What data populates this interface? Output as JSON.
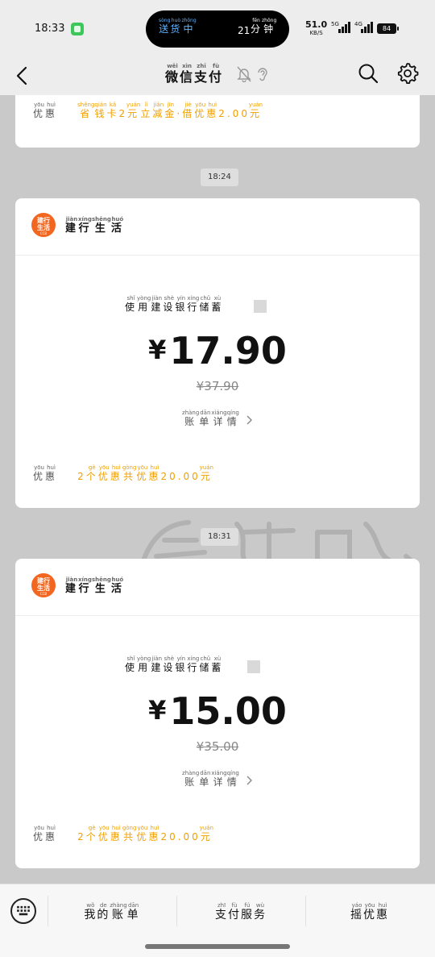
{
  "status_bar": {
    "time": "18:33",
    "island_left": [
      [
        "送",
        "sòng"
      ],
      [
        "货",
        "huò"
      ],
      [
        "中",
        "zhōng"
      ]
    ],
    "island_number": "21",
    "island_right": [
      [
        "分",
        "fēn"
      ],
      [
        "钟",
        "zhōng"
      ]
    ],
    "net_speed": "51.0",
    "net_unit": "KB/S",
    "sig1_label": "5G",
    "sig2_label": "4G",
    "battery": "84"
  },
  "header": {
    "title": [
      [
        "微",
        "wēi"
      ],
      [
        "信",
        "xìn"
      ],
      [
        "支",
        "zhī"
      ],
      [
        "付",
        "fù"
      ]
    ]
  },
  "top_card": {
    "discount_label": [
      [
        "优",
        "yōu"
      ],
      [
        "惠",
        "huì"
      ]
    ],
    "discount_pre": [
      [
        "省",
        "shěng"
      ],
      [
        "钱",
        "qián"
      ],
      [
        "卡",
        "kǎ"
      ]
    ],
    "discount_num": "2",
    "discount_mid": [
      [
        "元",
        "yuán"
      ],
      [
        "立",
        "lì"
      ],
      [
        "减",
        "jiǎn"
      ],
      [
        "金",
        "jīn"
      ]
    ],
    "discount_sep": "·",
    "discount_mid2": [
      [
        "借",
        "jiè"
      ],
      [
        "优",
        "yōu"
      ],
      [
        "惠",
        "huì"
      ]
    ],
    "discount_amount": "2.00",
    "discount_unit": [
      [
        "元",
        "yuán"
      ]
    ]
  },
  "messages": [
    {
      "time": "18:24",
      "merchant": [
        [
          "建",
          "jiàn"
        ],
        [
          "行",
          "xíng"
        ],
        [
          "生",
          "shēng"
        ],
        [
          "活",
          "huó"
        ]
      ],
      "logo_line1": "建行",
      "logo_line2": "生活",
      "logo_small": "CCB",
      "desc": [
        [
          "使",
          "shǐ"
        ],
        [
          "用",
          "yòng"
        ],
        [
          "建",
          "jiàn"
        ],
        [
          "设",
          "shè"
        ],
        [
          "银",
          "yín"
        ],
        [
          "行",
          "xíng"
        ],
        [
          "储",
          "chǔ"
        ],
        [
          "蓄",
          "xù"
        ]
      ],
      "amount": "17.90",
      "currency": "¥",
      "original": "¥37.90",
      "detail": [
        [
          "账",
          "zhàng"
        ],
        [
          "单",
          "dān"
        ],
        [
          "详",
          "xiáng"
        ],
        [
          "情",
          "qíng"
        ]
      ],
      "discount_label": [
        [
          "优",
          "yōu"
        ],
        [
          "惠",
          "huì"
        ]
      ],
      "discount_num": "2",
      "discount_mid": [
        [
          "个",
          "gè"
        ],
        [
          "优",
          "yōu"
        ],
        [
          "惠",
          "huì"
        ],
        [
          "共",
          "gòng"
        ],
        [
          "优",
          "yōu"
        ],
        [
          "惠",
          "huì"
        ]
      ],
      "discount_amount": "20.00",
      "discount_unit": [
        [
          "元",
          "yuán"
        ]
      ]
    },
    {
      "time": "18:31",
      "merchant": [
        [
          "建",
          "jiàn"
        ],
        [
          "行",
          "xíng"
        ],
        [
          "生",
          "shēng"
        ],
        [
          "活",
          "huó"
        ]
      ],
      "logo_line1": "建行",
      "logo_line2": "生活",
      "logo_small": "CCB",
      "desc": [
        [
          "使",
          "shǐ"
        ],
        [
          "用",
          "yòng"
        ],
        [
          "建",
          "jiàn"
        ],
        [
          "设",
          "shè"
        ],
        [
          "银",
          "yín"
        ],
        [
          "行",
          "xíng"
        ],
        [
          "储",
          "chǔ"
        ],
        [
          "蓄",
          "xù"
        ]
      ],
      "amount": "15.00",
      "currency": "¥",
      "original": "¥35.00",
      "detail": [
        [
          "账",
          "zhàng"
        ],
        [
          "单",
          "dān"
        ],
        [
          "详",
          "xiáng"
        ],
        [
          "情",
          "qíng"
        ]
      ],
      "discount_label": [
        [
          "优",
          "yōu"
        ],
        [
          "惠",
          "huì"
        ]
      ],
      "discount_num": "2",
      "discount_mid": [
        [
          "个",
          "gè"
        ],
        [
          "优",
          "yōu"
        ],
        [
          "惠",
          "huì"
        ],
        [
          "共",
          "gòng"
        ],
        [
          "优",
          "yōu"
        ],
        [
          "惠",
          "huì"
        ]
      ],
      "discount_amount": "20.00",
      "discount_unit": [
        [
          "元",
          "yuán"
        ]
      ]
    }
  ],
  "bottom_menu": [
    [
      [
        "我",
        "wǒ"
      ],
      [
        "的",
        "de"
      ],
      [
        "账",
        "zhàng"
      ],
      [
        "单",
        "dān"
      ]
    ],
    [
      [
        "支",
        "zhī"
      ],
      [
        "付",
        "fù"
      ],
      [
        "服",
        "fú"
      ],
      [
        "务",
        "wù"
      ]
    ],
    [
      [
        "摇",
        "yáo"
      ],
      [
        "优",
        "yōu"
      ],
      [
        "惠",
        "huì"
      ]
    ]
  ],
  "colors": {
    "accent_discount": "#f0a000",
    "logo_bg": "#f2661f",
    "island_text": "#5fb3ff"
  },
  "icons": [
    "back-icon",
    "bell-off-icon",
    "ear-icon",
    "search-icon",
    "gear-icon",
    "keyboard-icon"
  ]
}
